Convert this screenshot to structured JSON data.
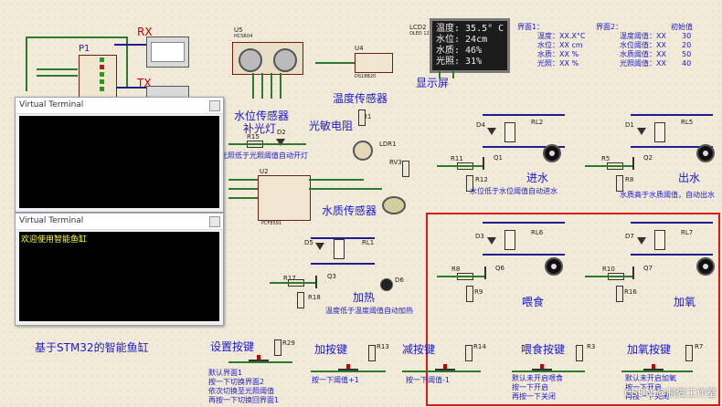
{
  "terminals": [
    {
      "title": "Virtual Terminal",
      "lines": []
    },
    {
      "title": "Virtual Terminal",
      "lines": [
        "欢迎使用智能鱼缸"
      ]
    }
  ],
  "lcd": {
    "label": "LCD2",
    "part": "OLED 128X64",
    "lines": [
      "温度: 35.5° C",
      "水位: 24cm",
      "水质: 46%",
      "光照: 31%"
    ],
    "caption": "显示屏"
  },
  "thresholds": {
    "interface1": "界面1：",
    "interface2": "界面2：",
    "initial": "初始值",
    "left": [
      "温度：XX.X°C",
      "水位：XX cm",
      "水质：XX %",
      "光照：XX %"
    ],
    "right": [
      "温度阈值：XX",
      "水位阈值：XX",
      "水质阈值：XX",
      "光照阈值：XX"
    ],
    "values": [
      "30",
      "20",
      "50",
      "40"
    ]
  },
  "labels": {
    "rx": "RX",
    "tx": "TX",
    "p1": "P1",
    "u5": "U5",
    "u5_part": "HCSR04",
    "u4": "U4",
    "u4_part": "DS18B20",
    "u2": "U2",
    "u2_part": "PCF8591",
    "water_level_sensor": "水位传感器",
    "fill_light": "补光灯",
    "temp_sensor": "温度传感器",
    "photoresistor": "光敏电阻",
    "water_quality_sensor": "水质传感器",
    "heating": "加热",
    "inlet": "进水",
    "outlet": "出水",
    "feed": "喂食",
    "oxygen": "加氧",
    "project_title": "基于STM32的智能鱼缸",
    "set_button": "设置按键",
    "add_button": "加按键",
    "sub_button": "减按键",
    "feed_button": "喂食按键",
    "oxygen_button": "加氧按键"
  },
  "notes": {
    "light_auto": "光照低于光照阈值自动开灯",
    "water_auto": "水位低于水位阈值自动进水",
    "quality_auto": "水质高于水质阈值，自动出水",
    "temp_auto": "温度低于温度阈值自动加热",
    "set_desc": [
      "默认界面1",
      "按一下切换界面2",
      "依次切换至光照阈值",
      "再按一下切换回界面1"
    ],
    "add_desc": "按一下阈值+1",
    "sub_desc": "按一下阈值-1",
    "feed_desc": [
      "默认未开启喂食",
      "按一下开启",
      "再按一下关闭"
    ],
    "oxygen_desc": [
      "默认未开启加氧",
      "按一下开启",
      "再按一下关闭"
    ]
  },
  "parts": {
    "r15": "R15",
    "d2": "D2",
    "r1": "R1",
    "ldr1": "LDR1",
    "rv3": "RV3",
    "d5": "D5",
    "rl1": "RL1",
    "r17": "R17",
    "q3": "Q3",
    "r18": "R18",
    "d6": "D6",
    "d4": "D4",
    "rl2": "RL2",
    "r11": "R11",
    "q1": "Q1",
    "r12": "R12",
    "d1": "D1",
    "rl5": "RL5",
    "r5": "R5",
    "q2": "Q2",
    "r8": "R8",
    "d3": "D3",
    "rl6": "RL6",
    "r8b": "R8",
    "q6": "Q6",
    "r9": "R9",
    "d7": "D7",
    "rl7": "RL7",
    "r10": "R10",
    "q7": "Q7",
    "r16": "R16",
    "r29": "R29",
    "r13": "R13",
    "r14": "R14",
    "r3": "R3",
    "r7": "R7"
  },
  "watermark": "CSDN @制做工作室"
}
